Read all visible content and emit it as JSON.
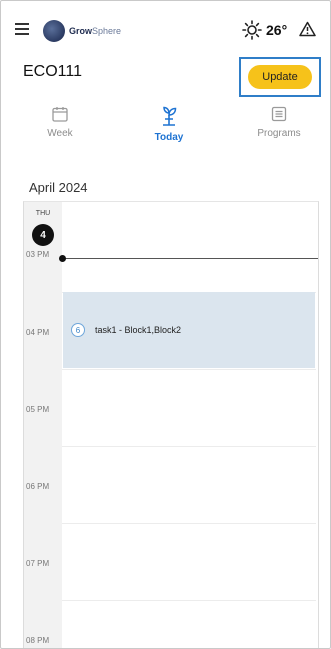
{
  "header": {
    "logo_primary": "Grow",
    "logo_secondary": "Sphere",
    "logo_mark": "·",
    "weather_icon": "sun-icon",
    "temperature": "26°",
    "alert_icon": "warning-triangle-icon"
  },
  "device": {
    "title": "ECO111",
    "update_label": "Update"
  },
  "tabs": [
    {
      "label": "Week",
      "icon": "calendar-icon",
      "active": false
    },
    {
      "label": "Today",
      "icon": "sprout-icon",
      "active": true
    },
    {
      "label": "Programs",
      "icon": "list-icon",
      "active": false
    }
  ],
  "calendar": {
    "month": "April 2024",
    "day_name": "THU",
    "day_number": "4",
    "hours": [
      "03 PM",
      "04 PM",
      "05 PM",
      "06 PM",
      "07 PM",
      "08 PM"
    ],
    "event": {
      "badge": "6",
      "text": "task1 -  Block1,Block2",
      "start_hour": "04 PM"
    }
  },
  "colors": {
    "accent_blue": "#1e73d2",
    "update_button": "#f6c21a",
    "highlight_border": "#2f7ec8",
    "event_bg": "#dbe5ee"
  }
}
